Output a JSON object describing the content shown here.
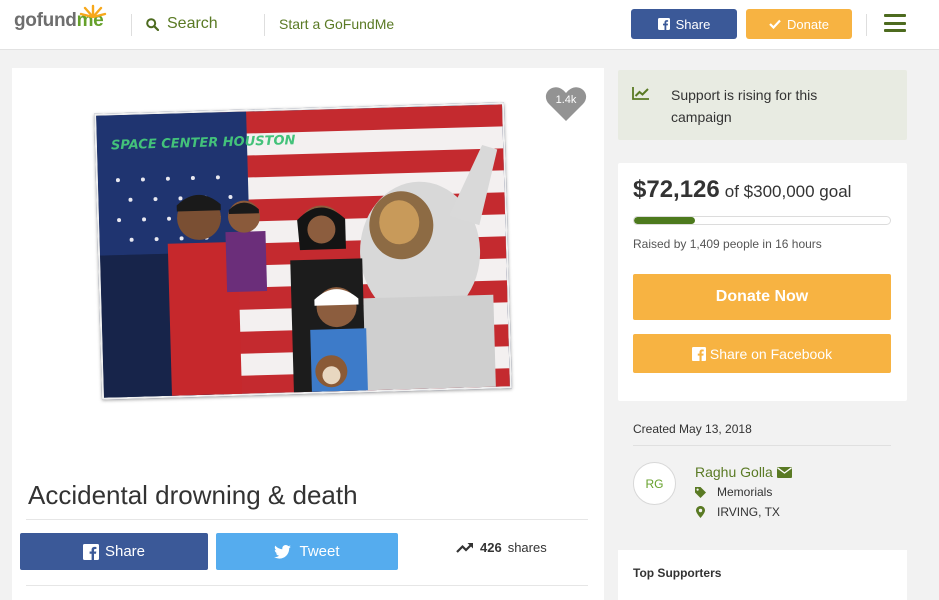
{
  "header": {
    "logo_go": "go",
    "logo_fund": "fund",
    "logo_me": "me",
    "search_label": "Search",
    "start_label": "Start a GoFundMe",
    "share_label": "Share",
    "donate_label": "Donate"
  },
  "campaign": {
    "hearts": "1.4k",
    "photo_caption": "SPACE CENTER HOUSTON",
    "title": "Accidental drowning & death",
    "share_label": "Share",
    "tweet_label": "Tweet",
    "shares_count": "426",
    "shares_label": "shares"
  },
  "sidebar": {
    "rising_text": "Support is rising for this campaign",
    "raised": "$72,126",
    "goal": "of $300,000 goal",
    "progress_fraction": 0.24,
    "raised_by": "Raised by 1,409 people in 16 hours",
    "donate_now": "Donate Now",
    "share_facebook": "Share on Facebook",
    "created": "Created May 13, 2018",
    "avatar_initials": "RG",
    "organizer": "Raghu Golla",
    "category": "Memorials",
    "location": "IRVING, TX",
    "top_supporters": "Top Supporters"
  },
  "colors": {
    "brand_green": "#66a12b",
    "facebook_blue": "#3b5998",
    "twitter_blue": "#55acee",
    "donate_orange": "#f7b342"
  }
}
